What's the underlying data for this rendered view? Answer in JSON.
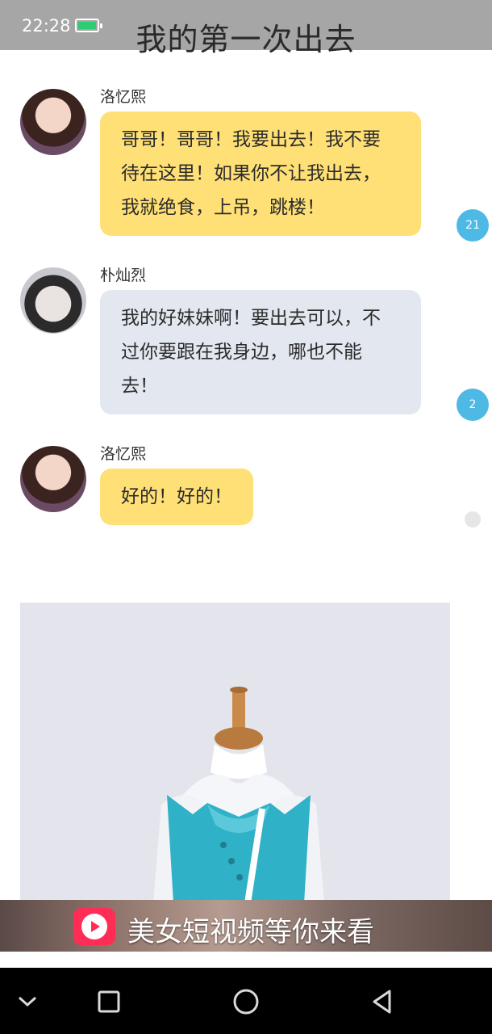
{
  "status_bar": {
    "time": "22:28",
    "battery_icon": "battery-charging-icon"
  },
  "header": {
    "title": "我的第一次出去"
  },
  "colors": {
    "bubble_yellow": "#ffe076",
    "bubble_gray": "#e3e8f0",
    "badge_blue": "#4fb9e6"
  },
  "messages": [
    {
      "sender": "洛忆熙",
      "lines": [
        "哥哥！哥哥！我要出去！我不要",
        "待在这里！如果你不让我出去，",
        "我就绝食，上吊，跳楼！"
      ],
      "count": "21"
    },
    {
      "sender": "朴灿烈",
      "lines": [
        "我的好妹妹啊！要出去可以，不",
        "过你要跟在我身边，哪也不能",
        "去！"
      ],
      "count": "2"
    },
    {
      "sender": "洛忆熙",
      "lines": [
        "好的！好的！"
      ],
      "count": ""
    }
  ],
  "ad": {
    "text": "美女短视频等你来看",
    "logo_icon": "video-play-logo-icon"
  },
  "nav_bar": {
    "icons": [
      "chevron-down-icon",
      "recent-apps-icon",
      "home-icon",
      "back-icon"
    ]
  }
}
